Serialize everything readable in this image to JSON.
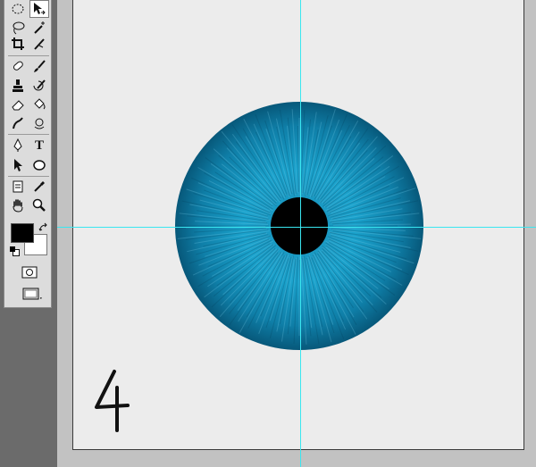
{
  "document": {
    "step_number": "4"
  },
  "colors": {
    "workspace_bg": "#c2c2c2",
    "canvas_bg": "#ececec",
    "guide": "#39e6f0",
    "iris": "#0f6d8f",
    "pupil": "#000000",
    "foreground": "#000000",
    "background": "#ffffff"
  },
  "toolbox": {
    "tools": [
      {
        "name": "elliptical-marquee",
        "icon": "ellipse-marquee-icon"
      },
      {
        "name": "move",
        "icon": "move-icon",
        "selected": true
      },
      {
        "name": "lasso",
        "icon": "lasso-icon"
      },
      {
        "name": "magic-wand",
        "icon": "magic-wand-icon"
      },
      {
        "name": "crop",
        "icon": "crop-icon"
      },
      {
        "name": "slice",
        "icon": "slice-icon"
      },
      {
        "name": "healing-brush",
        "icon": "bandage-icon"
      },
      {
        "name": "brush",
        "icon": "brush-icon"
      },
      {
        "name": "clone-stamp",
        "icon": "stamp-icon"
      },
      {
        "name": "history-brush",
        "icon": "history-brush-icon"
      },
      {
        "name": "eraser",
        "icon": "eraser-icon"
      },
      {
        "name": "paint-bucket",
        "icon": "paint-bucket-icon"
      },
      {
        "name": "smudge",
        "icon": "smudge-icon"
      },
      {
        "name": "dodge",
        "icon": "dodge-icon"
      },
      {
        "name": "pen",
        "icon": "pen-icon"
      },
      {
        "name": "type",
        "icon": "type-icon",
        "label": "T"
      },
      {
        "name": "path-selection",
        "icon": "arrow-icon"
      },
      {
        "name": "ellipse-shape",
        "icon": "ellipse-shape-icon"
      },
      {
        "name": "notes",
        "icon": "notes-icon"
      },
      {
        "name": "eyedropper",
        "icon": "eyedropper-icon"
      },
      {
        "name": "hand",
        "icon": "hand-icon"
      },
      {
        "name": "zoom",
        "icon": "zoom-icon"
      }
    ]
  }
}
